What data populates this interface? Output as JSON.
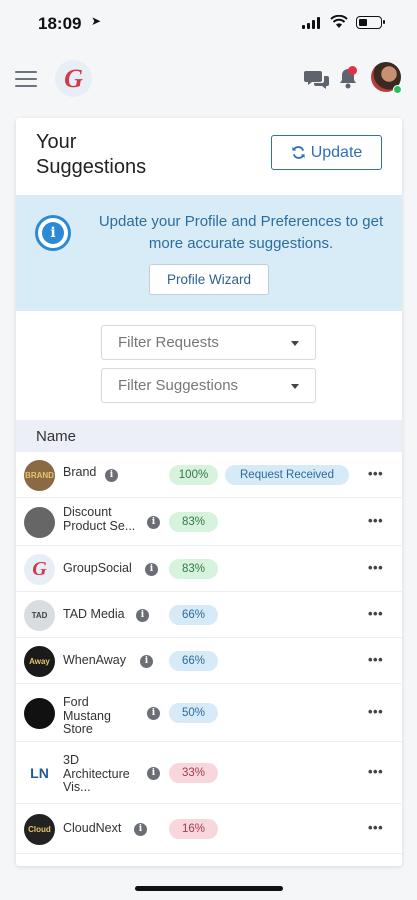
{
  "status_bar": {
    "time": "18:09"
  },
  "header": {
    "logo_letter": "G"
  },
  "suggestions": {
    "title_line1": "Your",
    "title_line2": "Suggestions",
    "update_label": "Update",
    "info_text": "Update your Profile and Preferences to get more accurate suggestions.",
    "wizard_label": "Profile Wizard",
    "filter_requests": "Filter Requests",
    "filter_suggestions": "Filter Suggestions",
    "column_name": "Name"
  },
  "rows": [
    {
      "name": "Brand",
      "percent": "100%",
      "tone": "green",
      "status": "Request Received",
      "logo_text": "BRAND",
      "logo_color": "#8a6a45"
    },
    {
      "name": "Discount Product Se...",
      "percent": "83%",
      "tone": "green",
      "logo_text": "",
      "logo_color": "#666"
    },
    {
      "name": "GroupSocial",
      "percent": "83%",
      "tone": "green",
      "logo_text": "G",
      "logo_color": "#e8eef6"
    },
    {
      "name": "TAD Media",
      "percent": "66%",
      "tone": "blue",
      "logo_text": "TAD",
      "logo_color": "#d9dde2"
    },
    {
      "name": "WhenAway",
      "percent": "66%",
      "tone": "blue",
      "logo_text": "Away",
      "logo_color": "#1a1a1a"
    },
    {
      "name": "Ford Mustang Store",
      "percent": "50%",
      "tone": "blue",
      "logo_text": "",
      "logo_color": "#111"
    },
    {
      "name": "3D Architecture Vis...",
      "percent": "33%",
      "tone": "red",
      "logo_text": "LN",
      "logo_color": "#fff"
    },
    {
      "name": "CloudNext",
      "percent": "16%",
      "tone": "red",
      "logo_text": "Cloud",
      "logo_color": "#222"
    }
  ],
  "more_label": "•••",
  "info_glyph": "i"
}
